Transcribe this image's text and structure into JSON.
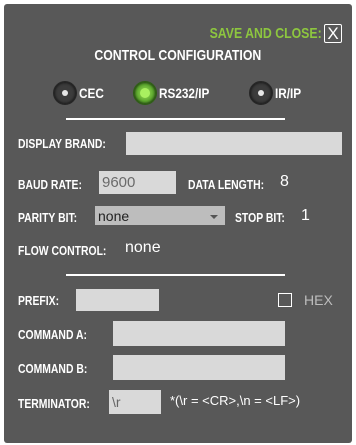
{
  "header": {
    "save_close_label": "SAVE AND CLOSE:",
    "close_glyph": "X",
    "title": "CONTROL CONFIGURATION",
    "accent_color": "#8dc63f"
  },
  "control_type": {
    "options": [
      {
        "label": "CEC",
        "selected": false
      },
      {
        "label": "RS232/IP",
        "selected": true
      },
      {
        "label": "IR/IP",
        "selected": false
      }
    ]
  },
  "settings": {
    "display_brand_label": "DISPLAY BRAND:",
    "display_brand_value": "",
    "baud_rate_label": "BAUD RATE:",
    "baud_rate_value": "9600",
    "data_length_label": "DATA LENGTH:",
    "data_length_value": "8",
    "parity_bit_label": "PARITY BIT:",
    "parity_bit_value": "none",
    "stop_bit_label": "STOP BIT:",
    "stop_bit_value": "1",
    "flow_control_label": "FLOW CONTROL:",
    "flow_control_value": "none"
  },
  "commands": {
    "prefix_label": "PREFIX:",
    "prefix_value": "",
    "hex_label": "HEX",
    "hex_checked": false,
    "command_a_label": "COMMAND A:",
    "command_a_value": "",
    "command_b_label": "COMMAND B:",
    "command_b_value": "",
    "terminator_label": "TERMINATOR:",
    "terminator_value": "\\r",
    "terminator_note": "*(\\r = <CR>,\\n = <LF>)"
  }
}
